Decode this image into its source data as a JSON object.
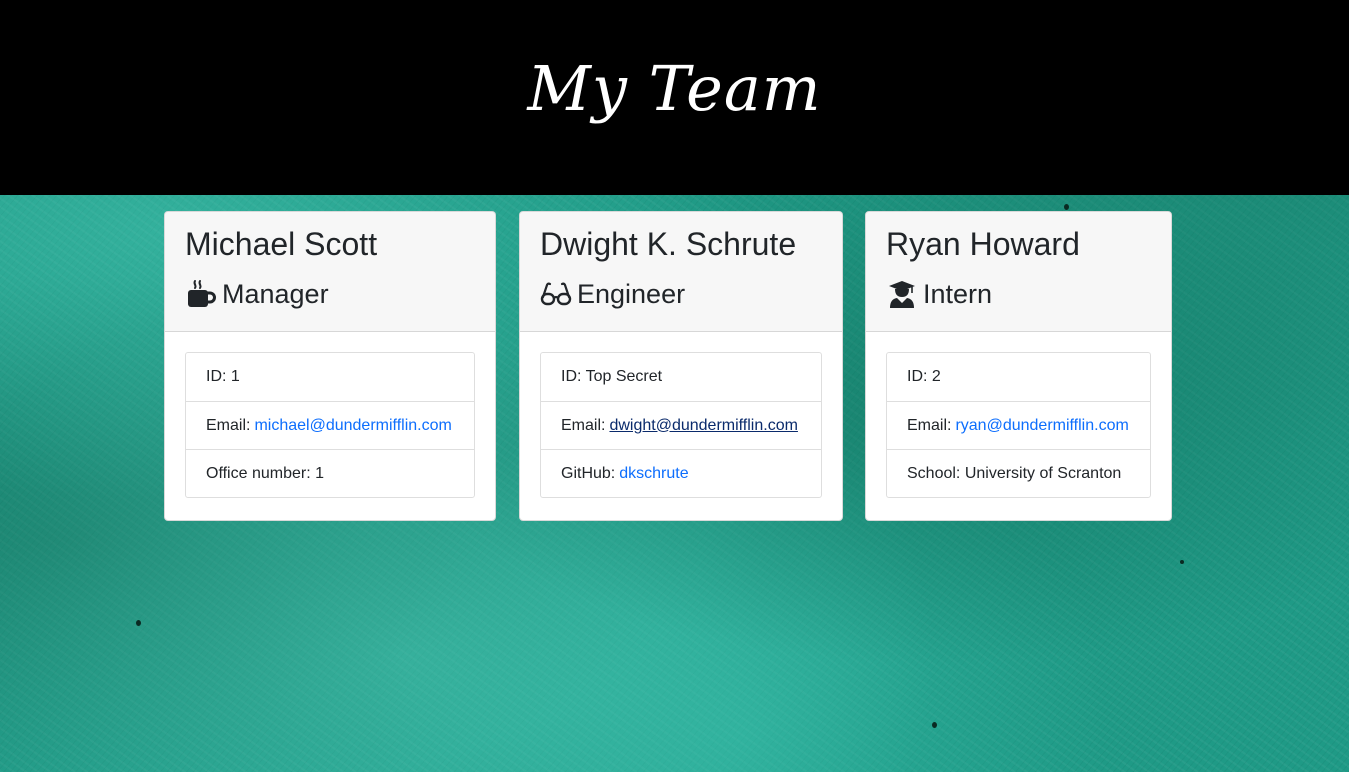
{
  "header": {
    "title": "My Team"
  },
  "cards": [
    {
      "name": "Michael Scott",
      "role": "Manager",
      "role_icon": "mug-icon",
      "items": [
        {
          "label": "ID: 1",
          "value": ""
        },
        {
          "label": "Email:",
          "value": "michael@dundermifflin.com"
        },
        {
          "label": "Office number: 1",
          "value": ""
        }
      ]
    },
    {
      "name": "Dwight K. Schrute",
      "role": "Engineer",
      "role_icon": "glasses-icon",
      "items": [
        {
          "label": "ID: Top Secret",
          "value": ""
        },
        {
          "label": "Email:",
          "value": "dwight@dundermifflin.com"
        },
        {
          "label": "GitHub:",
          "value": "dkschrute"
        }
      ]
    },
    {
      "name": "Ryan Howard",
      "role": "Intern",
      "role_icon": "graduate-icon",
      "items": [
        {
          "label": "ID: 2",
          "value": ""
        },
        {
          "label": "Email:",
          "value": "ryan@dundermifflin.com"
        },
        {
          "label": "School: University of Scranton",
          "value": ""
        }
      ]
    }
  ],
  "colors": {
    "header_bg": "#000000",
    "link": "#0d6efd",
    "background": "#1f9a86"
  }
}
